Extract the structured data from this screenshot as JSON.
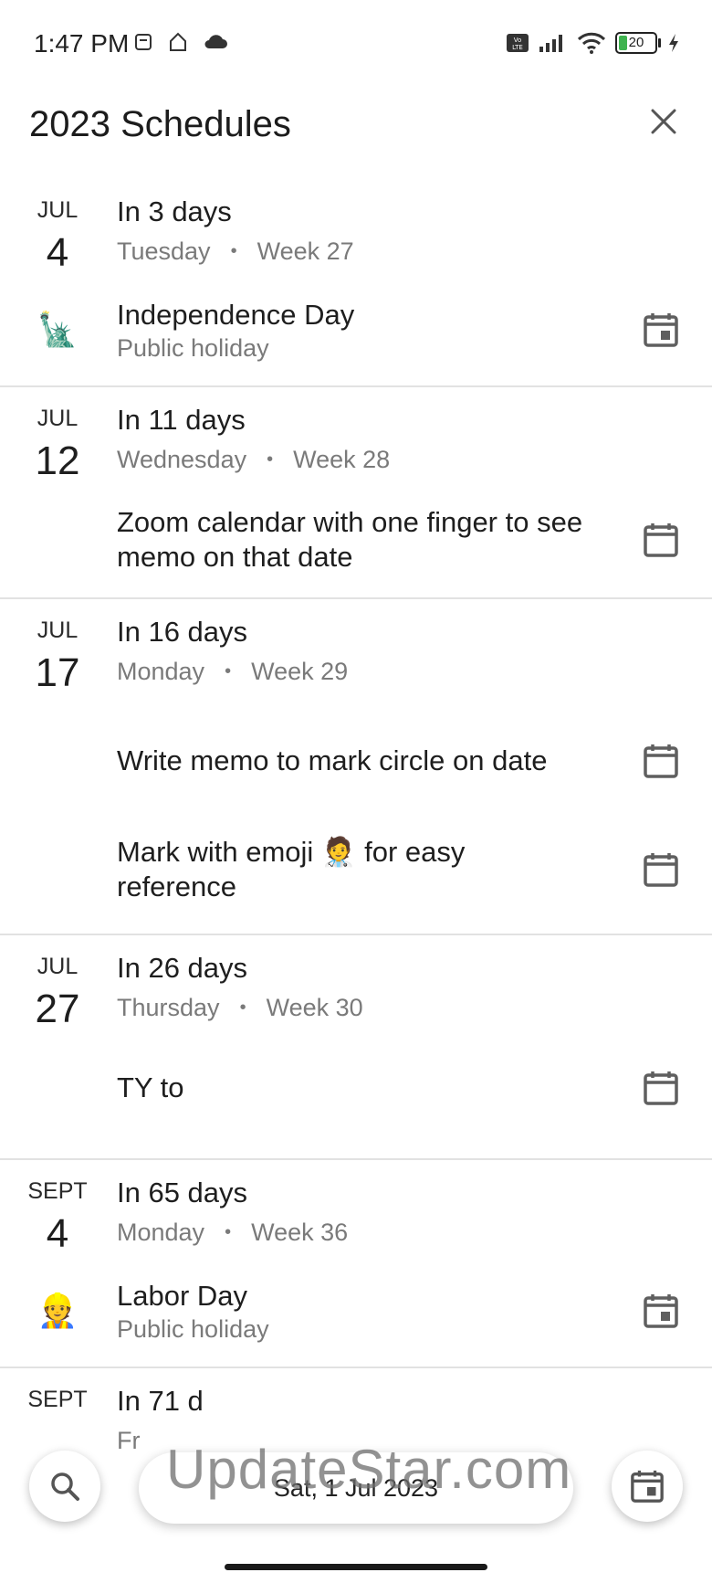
{
  "status_bar": {
    "time": "1:47 PM",
    "battery_level": "20",
    "icons": [
      "android-icon",
      "home-icon",
      "cloud-icon",
      "volte-icon",
      "signal-icon",
      "wifi-icon",
      "battery-icon",
      "charging-icon"
    ]
  },
  "header": {
    "title": "2023 Schedules",
    "close_icon": "close-icon"
  },
  "sections": [
    {
      "month": "JUL",
      "day": "4",
      "relative": "In 3 days",
      "weekday": "Tuesday",
      "week": "Week 27",
      "events": [
        {
          "emoji": "🗽",
          "title": "Independence Day",
          "subtitle": "Public holiday",
          "icon": "calendar-filled-icon"
        }
      ]
    },
    {
      "month": "JUL",
      "day": "12",
      "relative": "In 11 days",
      "weekday": "Wednesday",
      "week": "Week 28",
      "events": [
        {
          "emoji": "",
          "title": "Zoom calendar with one finger to see memo on that date",
          "subtitle": "",
          "icon": "calendar-outline-icon"
        }
      ]
    },
    {
      "month": "JUL",
      "day": "17",
      "relative": "In 16 days",
      "weekday": "Monday",
      "week": "Week 29",
      "events": [
        {
          "emoji": "",
          "title": "Write memo to mark circle on date",
          "subtitle": "",
          "icon": "calendar-outline-icon"
        },
        {
          "emoji": "",
          "title": "Mark with emoji 🧑‍⚕️ for easy reference",
          "subtitle": "",
          "icon": "calendar-outline-icon"
        }
      ]
    },
    {
      "month": "JUL",
      "day": "27",
      "relative": "In 26 days",
      "weekday": "Thursday",
      "week": "Week 30",
      "events": [
        {
          "emoji": "",
          "title": "TY to",
          "subtitle": "",
          "icon": "calendar-outline-icon"
        }
      ]
    },
    {
      "month": "SEPT",
      "day": "4",
      "relative": "In 65 days",
      "weekday": "Monday",
      "week": "Week 36",
      "events": [
        {
          "emoji": "👷",
          "title": "Labor Day",
          "subtitle": "Public holiday",
          "icon": "calendar-filled-icon"
        }
      ]
    },
    {
      "month": "SEPT",
      "day": "",
      "relative": "In 71 d",
      "weekday": "Fr",
      "week": "",
      "events": []
    }
  ],
  "bottom": {
    "date_label": "Sat, 1 Jul 2023",
    "search_icon": "search-icon",
    "today_icon": "calendar-today-icon",
    "watermark": "UpdateStar.com"
  },
  "colors": {
    "text_primary": "#1e1e1e",
    "text_secondary": "#7a7a7a",
    "divider": "#e2e2e2",
    "battery_fill": "#3fb34f"
  }
}
